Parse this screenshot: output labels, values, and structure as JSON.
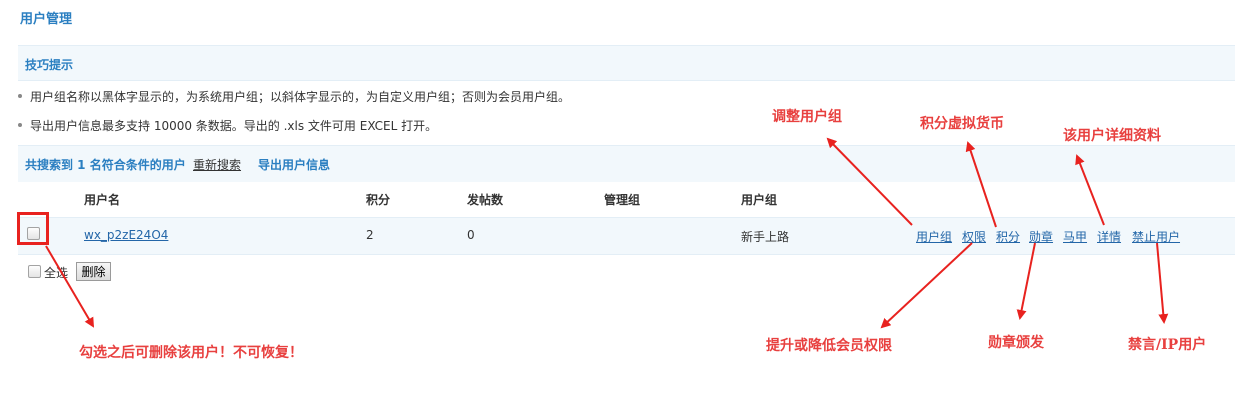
{
  "page": {
    "title": "用户管理"
  },
  "tips": {
    "title": "技巧提示",
    "items": [
      "用户组名称以黑体字显示的，为系统用户组；以斜体字显示的，为自定义用户组；否则为会员用户组。",
      "导出用户信息最多支持 10000 条数据。导出的 .xls 文件可用 EXCEL 打开。"
    ]
  },
  "search": {
    "result_text": "共搜索到 1 名符合条件的用户",
    "resort_label": "重新搜索",
    "export_label": "导出用户信息"
  },
  "table": {
    "headers": [
      "用户名",
      "积分",
      "发帖数",
      "管理组",
      "用户组"
    ],
    "rows": [
      {
        "username": "wx_p2zE24O4",
        "credits": "2",
        "posts": "0",
        "admin_group": "",
        "user_group": "新手上路"
      }
    ],
    "actions": [
      "用户组",
      "权限",
      "积分",
      "勋章",
      "马甲",
      "详情",
      "禁止用户"
    ]
  },
  "footer": {
    "select_all_label": "全选",
    "delete_label": "删除"
  },
  "annotations": {
    "adjust_group": "调整用户组",
    "credits_currency": "积分虚拟货币",
    "user_details": "该用户详细资料",
    "permissions": "提升或降低会员权限",
    "medal": "勋章颁发",
    "ban": "禁言/IP用户",
    "delete_warning": "勾选之后可删除该用户！不可恢复！"
  },
  "colors": {
    "annotation": "#e8403f",
    "accent": "#2b7fc1",
    "row_bg": "#f2f8fc"
  }
}
